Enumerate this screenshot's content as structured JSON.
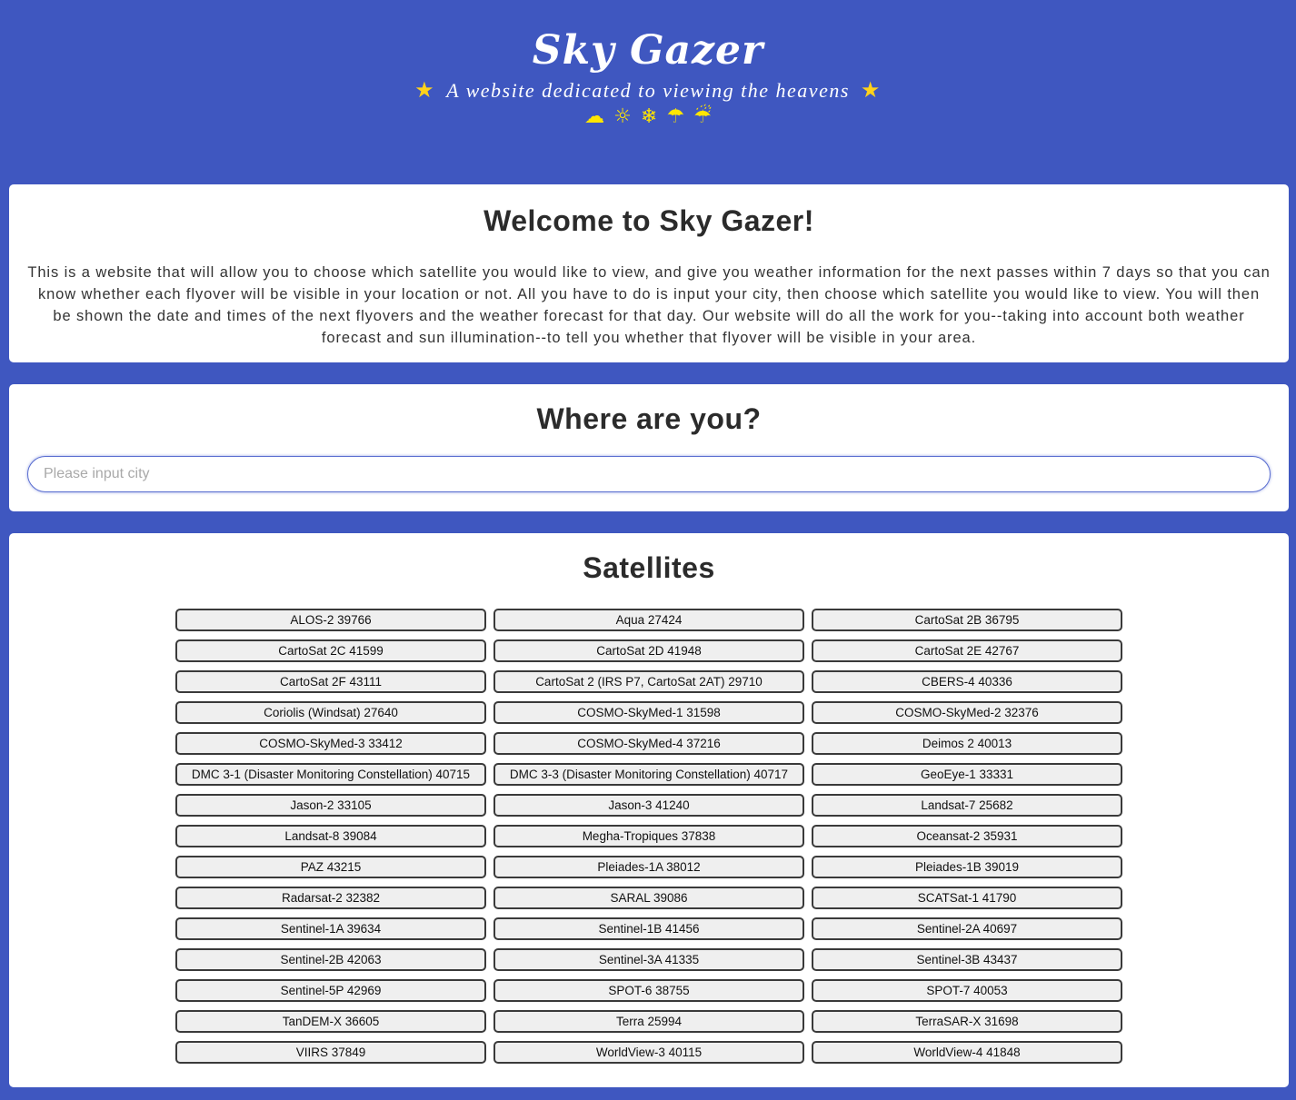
{
  "header": {
    "title": "Sky Gazer",
    "tagline": "A website dedicated to viewing the heavens",
    "star_glyph": "★",
    "weather_icons": [
      {
        "name": "cloud-icon",
        "glyph": "☁"
      },
      {
        "name": "sun-icon",
        "glyph": "☼"
      },
      {
        "name": "snowflake-icon",
        "glyph": "❄"
      },
      {
        "name": "umbrella-icon",
        "glyph": "☂"
      },
      {
        "name": "rain-cloud-icon",
        "glyph": "☔"
      }
    ],
    "colors": {
      "background": "#3f57c0",
      "star": "#ffd21a",
      "weather": "#ffe600"
    }
  },
  "welcome": {
    "heading": "Welcome to Sky Gazer!",
    "body": "This is a website that will allow you to choose which satellite you would like to view, and give you weather information for the next passes within 7 days so that you can know whether each flyover will be visible in your location or not. All you have to do is input your city, then choose which satellite you would like to view. You will then be shown the date and times of the next flyovers and the weather forecast for that day. Our website will do all the work for you--taking into account both weather forecast and sun illumination--to tell you whether that flyover will be visible in your area."
  },
  "location": {
    "heading": "Where are you?",
    "city_value": "",
    "city_placeholder": "Please input city"
  },
  "satellites": {
    "heading": "Satellites",
    "items": [
      "ALOS-2 39766",
      "Aqua 27424",
      "CartoSat 2B 36795",
      "CartoSat 2C 41599",
      "CartoSat 2D 41948",
      "CartoSat 2E 42767",
      "CartoSat 2F 43111",
      "CartoSat 2 (IRS P7, CartoSat 2AT) 29710",
      "CBERS-4 40336",
      "Coriolis (Windsat) 27640",
      "COSMO-SkyMed-1 31598",
      "COSMO-SkyMed-2 32376",
      "COSMO-SkyMed-3 33412",
      "COSMO-SkyMed-4 37216",
      "Deimos 2 40013",
      "DMC 3-1 (Disaster Monitoring Constellation) 40715",
      "DMC 3-3 (Disaster Monitoring Constellation) 40717",
      "GeoEye-1 33331",
      "Jason-2 33105",
      "Jason-3 41240",
      "Landsat-7 25682",
      "Landsat-8 39084",
      "Megha-Tropiques 37838",
      "Oceansat-2 35931",
      "PAZ 43215",
      "Pleiades-1A 38012",
      "Pleiades-1B 39019",
      "Radarsat-2 32382",
      "SARAL 39086",
      "SCATSat-1 41790",
      "Sentinel-1A 39634",
      "Sentinel-1B 41456",
      "Sentinel-2A 40697",
      "Sentinel-2B 42063",
      "Sentinel-3A 41335",
      "Sentinel-3B 43437",
      "Sentinel-5P 42969",
      "SPOT-6 38755",
      "SPOT-7 40053",
      "TanDEM-X 36605",
      "Terra 25994",
      "TerraSAR-X 31698",
      "VIIRS 37849",
      "WorldView-3 40115",
      "WorldView-4 41848"
    ]
  }
}
